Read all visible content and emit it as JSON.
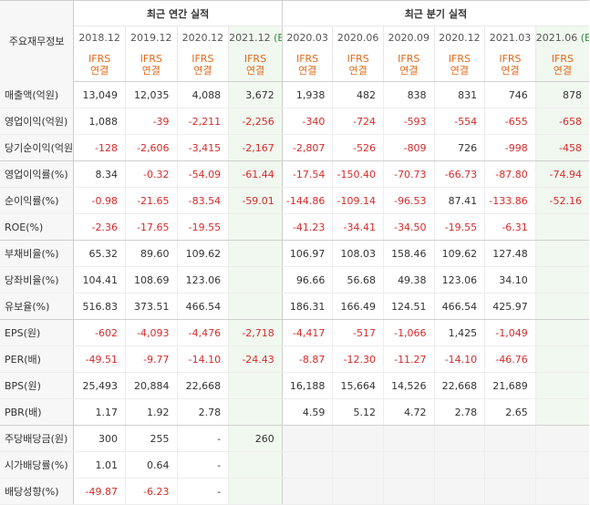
{
  "header": {
    "label": "주요재무정보",
    "annual_title": "최근 연간 실적",
    "quarter_title": "최근 분기 실적",
    "annual_periods": [
      {
        "date": "2018.12",
        "est": "",
        "line1": "IFRS",
        "line2": "연결"
      },
      {
        "date": "2019.12",
        "est": "",
        "line1": "IFRS",
        "line2": "연결"
      },
      {
        "date": "2020.12",
        "est": "",
        "line1": "IFRS",
        "line2": "연결"
      },
      {
        "date": "2021.12",
        "est": "(E)",
        "line1": "IFRS",
        "line2": "연결"
      }
    ],
    "quarter_periods": [
      {
        "date": "2020.03",
        "est": "",
        "line1": "IFRS",
        "line2": "연결"
      },
      {
        "date": "2020.06",
        "est": "",
        "line1": "IFRS",
        "line2": "연결"
      },
      {
        "date": "2020.09",
        "est": "",
        "line1": "IFRS",
        "line2": "연결"
      },
      {
        "date": "2020.12",
        "est": "",
        "line1": "IFRS",
        "line2": "연결"
      },
      {
        "date": "2021.03",
        "est": "",
        "line1": "IFRS",
        "line2": "연결"
      },
      {
        "date": "2021.06",
        "est": "(E)",
        "line1": "IFRS",
        "line2": "연결"
      }
    ]
  },
  "rows": [
    {
      "label": "매출액(억원)",
      "values": [
        "13,049",
        "12,035",
        "4,088",
        "3,672",
        "1,938",
        "482",
        "838",
        "831",
        "746",
        "878"
      ]
    },
    {
      "label": "영업이익(억원)",
      "values": [
        "1,088",
        "-39",
        "-2,211",
        "-2,256",
        "-340",
        "-724",
        "-593",
        "-554",
        "-655",
        "-658"
      ]
    },
    {
      "label": "당기순이익(억원)",
      "values": [
        "-128",
        "-2,606",
        "-3,415",
        "-2,167",
        "-2,807",
        "-526",
        "-809",
        "726",
        "-998",
        "-458"
      ]
    },
    {
      "label": "영업이익률(%)",
      "values": [
        "8.34",
        "-0.32",
        "-54.09",
        "-61.44",
        "-17.54",
        "-150.40",
        "-70.73",
        "-66.73",
        "-87.80",
        "-74.94"
      ]
    },
    {
      "label": "순이익률(%)",
      "values": [
        "-0.98",
        "-21.65",
        "-83.54",
        "-59.01",
        "-144.86",
        "-109.14",
        "-96.53",
        "87.41",
        "-133.86",
        "-52.16"
      ]
    },
    {
      "label": "ROE(%)",
      "values": [
        "-2.36",
        "-17.65",
        "-19.55",
        "",
        "-41.23",
        "-34.41",
        "-34.50",
        "-19.55",
        "-6.31",
        ""
      ]
    },
    {
      "label": "부채비율(%)",
      "values": [
        "65.32",
        "89.60",
        "109.62",
        "",
        "106.97",
        "108.03",
        "158.46",
        "109.62",
        "127.48",
        ""
      ]
    },
    {
      "label": "당좌비율(%)",
      "values": [
        "104.41",
        "108.69",
        "123.06",
        "",
        "96.66",
        "56.68",
        "49.38",
        "123.06",
        "34.10",
        ""
      ]
    },
    {
      "label": "유보율(%)",
      "values": [
        "516.83",
        "373.51",
        "466.54",
        "",
        "186.31",
        "166.49",
        "124.51",
        "466.54",
        "425.97",
        ""
      ]
    },
    {
      "label": "EPS(원)",
      "values": [
        "-602",
        "-4,093",
        "-4,476",
        "-2,718",
        "-4,417",
        "-517",
        "-1,066",
        "1,425",
        "-1,049",
        ""
      ]
    },
    {
      "label": "PER(배)",
      "values": [
        "-49.51",
        "-9.77",
        "-14.10",
        "-24.43",
        "-8.87",
        "-12.30",
        "-11.27",
        "-14.10",
        "-46.76",
        ""
      ]
    },
    {
      "label": "BPS(원)",
      "values": [
        "25,493",
        "20,884",
        "22,668",
        "",
        "16,188",
        "15,664",
        "14,526",
        "22,668",
        "21,689",
        ""
      ]
    },
    {
      "label": "PBR(배)",
      "values": [
        "1.17",
        "1.92",
        "2.78",
        "",
        "4.59",
        "5.12",
        "4.72",
        "2.78",
        "2.65",
        ""
      ]
    },
    {
      "label": "주당배당금(원)",
      "values": [
        "300",
        "255",
        "-",
        "260",
        "",
        "",
        "",
        "",
        "",
        ""
      ]
    },
    {
      "label": "시가배당률(%)",
      "values": [
        "1.01",
        "0.64",
        "-",
        "",
        "",
        "",
        "",
        "",
        "",
        ""
      ]
    },
    {
      "label": "배당성향(%)",
      "values": [
        "-49.87",
        "-6.23",
        "-",
        "",
        "",
        "",
        "",
        "",
        "",
        ""
      ]
    }
  ],
  "colors": {
    "negative": "#d62b2b",
    "ifrs": "#e06a1d",
    "estimate": "#2f8d3c",
    "forecast_bg": "#f1f8ef"
  }
}
